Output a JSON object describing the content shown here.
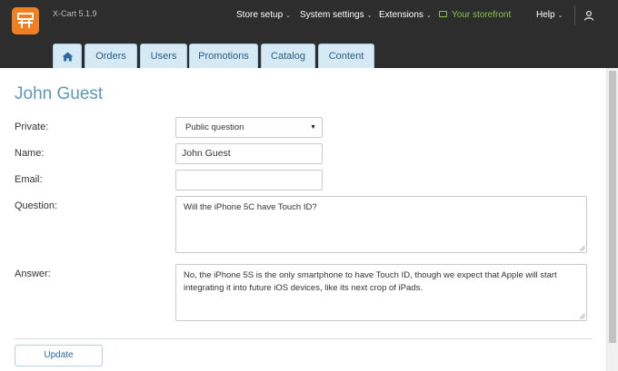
{
  "app": {
    "version": "X-Cart 5.1.9"
  },
  "topnav": {
    "store_setup": "Store setup",
    "system_settings": "System settings",
    "extensions": "Extensions",
    "storefront": "Your storefront",
    "help": "Help"
  },
  "tabs": [
    "Orders",
    "Users",
    "Promotions",
    "Catalog",
    "Content"
  ],
  "page": {
    "title": "John Guest"
  },
  "form": {
    "private_label": "Private:",
    "private_value": "Public question",
    "name_label": "Name:",
    "name_value": "John Guest",
    "email_label": "Email:",
    "email_value": "",
    "question_label": "Question:",
    "question_value": "Will the iPhone 5C have Touch ID?",
    "answer_label": "Answer:",
    "answer_value": "No, the iPhone 5S is the only smartphone to have Touch ID, though we expect that Apple will start integrating it into future iOS devices, like its next crop of iPads.",
    "update_label": "Update"
  },
  "colors": {
    "header_bg": "#2d2d2d",
    "logo": "#f07f1f",
    "title": "#5d97bd",
    "storefront": "#8bc34a",
    "tab_bg": "#d6eaf6"
  },
  "icons": {
    "logo": "xcart-logo-icon",
    "storefront": "monitor-icon",
    "user": "user-icon",
    "home": "home-icon",
    "caret": "chevron-down-icon",
    "select_arrow": "triangle-down-icon"
  }
}
